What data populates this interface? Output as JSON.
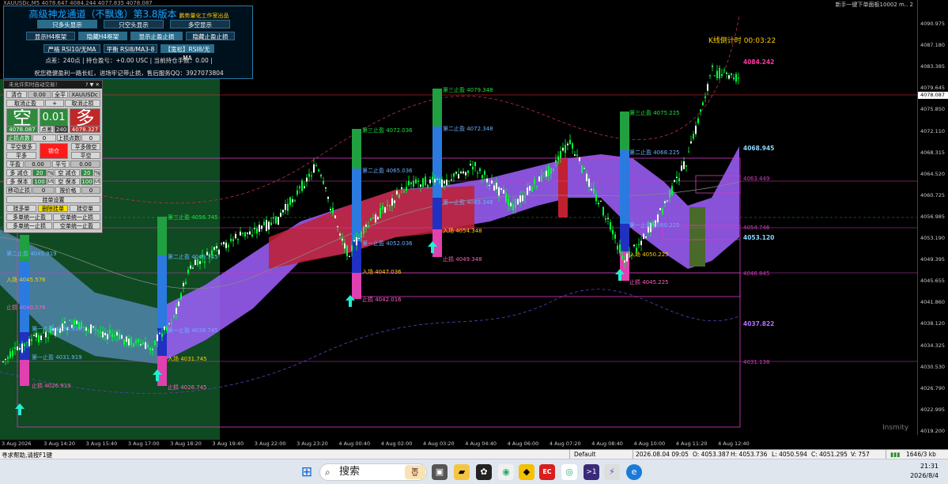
{
  "window": {
    "title": "XAUUSDc,M5 4078.647 4084.244 4077.835 4078.087",
    "top_right": "新手一键下单面板10002 m.. 2"
  },
  "info_panel": {
    "title": "高级神龙通道（不飘逸）第3.8版本",
    "studio": "鹏势量化工作室出品",
    "row1": [
      "只多头显示",
      "只空头显示",
      "多空显示"
    ],
    "row2": [
      "显示H4框架",
      "隐藏H4框架",
      "显示止盈止损",
      "隐藏止盈止损"
    ],
    "row3": [
      "严格 RSI10/无MA",
      "平衡 RSI8/MA3-8",
      "【宽松】RSI8/无MA"
    ],
    "line_points": "点差：240点 | 持仓盈亏：+0.00 USC | 当前持仓手数：0.00 |",
    "line_contact": "祝您稳健盈利一路长虹，进场牢记带止损，售后服务QQ：3927073804"
  },
  "trade_panel": {
    "header": "未允许实时自动交易！",
    "header_ctrl": "? ▼ ✕",
    "clear_label": "清仓",
    "clear_value": "0.00",
    "all_label": "全平",
    "symbol": "XAUUSDc",
    "cancel_buy": "取消止盈",
    "plus": "+",
    "cancel_sell": "取消止损",
    "sell_char": "空",
    "lot": "0.01",
    "buy_char": "多",
    "sell_price": "4078.087",
    "spread_label": "点差",
    "spread_value": "240",
    "buy_price": "4078.327",
    "stop_label_l": "止损点数",
    "stop_value_l": "0",
    "stop_label_r": "上损点数",
    "stop_value_r": "0",
    "flat_sell_label": "平空做多",
    "lock_label": "锁仓",
    "flat_buy_label": "平多做空",
    "flat_label_l": "平多",
    "flat_label_r": "平空",
    "ping_label": "平盈",
    "ping_value": "0.00",
    "ping_label2": "平亏",
    "ping_value2": "0.00",
    "duo_jian": "多 减仓",
    "duo_jian_v": "20",
    "pct1": "%",
    "kong_jian": "空 减仓",
    "kong_jian_v": "20",
    "pct2": "%",
    "duo_bao": "多 保本",
    "duo_bao_v": "100",
    "usc1": "USC",
    "kong_bao": "空 保本",
    "kong_bao_v": "100",
    "usc2": "USC",
    "move_stop": "移动止损",
    "move_stop_v": "0",
    "trigger": "按价格",
    "trigger_v": "0",
    "pending_header": "挂单设置",
    "pending_buy": "挂多单",
    "pending_del": "删除挂单",
    "pending_sell": "挂空单",
    "one_key1": "多单统一止盈",
    "one_key2": "空单统一止损",
    "one_key3": "多单统一止损",
    "one_key4": "空单统一止盈"
  },
  "price_axis": {
    "ticks": [
      "4090.975",
      "4087.180",
      "4083.385",
      "4079.645",
      "4075.850",
      "4072.110",
      "4068.315",
      "4064.520",
      "4060.725",
      "4056.985",
      "4053.190",
      "4049.395",
      "4045.655",
      "4041.860",
      "4038.120",
      "4034.325",
      "4030.530",
      "4026.790",
      "4022.995",
      "4019.200"
    ],
    "current": "4078.087"
  },
  "time_axis": {
    "ticks": [
      "3 Aug 2026",
      "3 Aug 14:20",
      "3 Aug 15:40",
      "3 Aug 17:00",
      "3 Aug 18:20",
      "3 Aug 19:40",
      "3 Aug 22:00",
      "3 Aug 23:20",
      "4 Aug 00:40",
      "4 Aug 02:00",
      "4 Aug 03:20",
      "4 Aug 04:40",
      "4 Aug 06:00",
      "4 Aug 07:20",
      "4 Aug 08:40",
      "4 Aug 10:00",
      "4 Aug 11:20",
      "4 Aug 12:40"
    ]
  },
  "chart_labels": {
    "countdown": "K线倒计时 00:03:22",
    "level_4084": "4084.242",
    "level_4068": "4068.945",
    "level_4063": "4063.449",
    "level_4054": "4054.746",
    "level_4053": "4053.120",
    "level_4046": "4046.845",
    "level_4037": "4037.822",
    "level_4031": "4031.138",
    "tp3_a": "第三止盈 4079.348",
    "tp2_a": "第二止盈 4072.348",
    "tp1_a": "第一止盈 4065.348",
    "entry_a": "入场 4054.348",
    "sl_a": "止损 4049.348",
    "tp3_b": "第三止盈 4072.036",
    "tp2_b": "第二止盈 4065.036",
    "tp1_b": "第一止盈 4052.036",
    "entry_b": "入场 4047.036",
    "sl_b": "止损 4042.016",
    "tp3_c": "第三止盈 4075.225",
    "tp2_c": "第二止盈 4068.225",
    "tp1_c": "第一止盈 4060.225",
    "entry_c": "入场 4050.225",
    "sl_c": "止损 4045.225",
    "tp3_d": "第三止盈 4056.745",
    "tp2_d": "第二止盈 4049.745",
    "tp1_d": "第一止盈 4038.745",
    "entry_d": "入场 4031.745",
    "sl_d": "止损 4026.745",
    "tp2_e": "第二止盈 4045.919",
    "tp1_e": "第一止盈 4038.919",
    "entry_e": "入场 4045.576",
    "sl_e": "止损 4040.576",
    "tp_f": "第一止盈 4031.919",
    "sl_f": "止损 4026.919",
    "watermark": "Insmity"
  },
  "status_bar": {
    "help": "寻求帮助,请按F1键",
    "profile": "Default",
    "datetime": "2026.08.04 09:05",
    "open": "O: 4053.387",
    "high": "H: 4053.736",
    "low": "L: 4050.594",
    "close": "C: 4051.295",
    "volume": "V: 757",
    "traffic": "1646/3 kb"
  },
  "taskbar": {
    "search": "搜索",
    "time": "21:31",
    "date": "2026/8/4"
  },
  "colors": {
    "bull": "#00ff3a",
    "purple_band": "#a060ff",
    "red_band": "#c02030",
    "teal_band": "#1a7a6a",
    "magenta_line": "#d63cc0",
    "cyan_arrow": "#20f0d0"
  }
}
